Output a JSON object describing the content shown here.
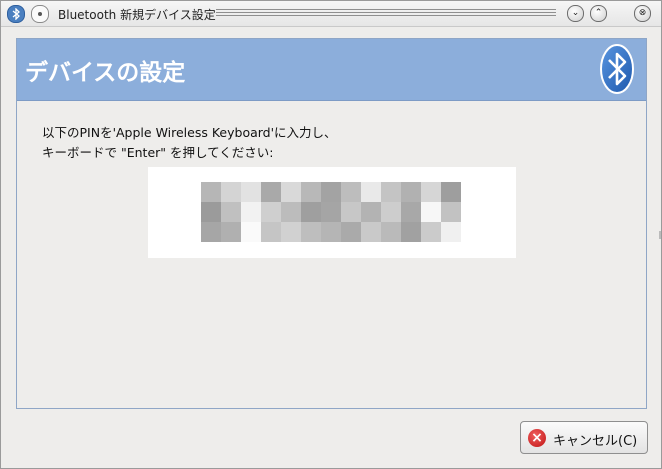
{
  "window": {
    "title": "Bluetooth 新規デバイス設定",
    "min_glyph": "⌄",
    "max_glyph": "⌃",
    "close_glyph": "⊗"
  },
  "header": {
    "title": "デバイスの設定",
    "icon": "bluetooth-icon"
  },
  "instructions": {
    "line1": "以下のPINを'Apple Wireless Keyboard'に入力し、",
    "line2": "キーボードで \"Enter\" を押してください:"
  },
  "pin": {
    "pixelated": true,
    "cells": [
      [
        "#b6b6b6",
        "#d4d4d4",
        "#e2e2e2",
        "#a9a9a9",
        "#d9d9d9",
        "#b8b8b8",
        "#a3a3a3",
        "#bdbdbd",
        "#e9e9e9",
        "#c4c4c4",
        "#b1b1b1",
        "#d6d6d6",
        "#9e9e9e"
      ],
      [
        "#9b9b9b",
        "#c0c0c0",
        "#f2f2f2",
        "#cfcfcf",
        "#bcbcbc",
        "#9f9f9f",
        "#a5a5a5",
        "#c7c7c7",
        "#b3b3b3",
        "#cdcdcd",
        "#a8a8a8",
        "#f7f7f7",
        "#c2c2c2"
      ],
      [
        "#a6a6a6",
        "#b0b0b0",
        "#fafafa",
        "#c5c5c5",
        "#d1d1d1",
        "#bebebe",
        "#b5b5b5",
        "#aaaaaa",
        "#c9c9c9",
        "#bababa",
        "#a1a1a1",
        "#cbcbcb",
        "#f0f0f0"
      ]
    ]
  },
  "buttons": {
    "cancel": "キャンセル(C)"
  },
  "colors": {
    "header_band": "#8caedb",
    "bluetooth_blue": "#2c6cc4",
    "cancel_red": "#d42a2a"
  }
}
